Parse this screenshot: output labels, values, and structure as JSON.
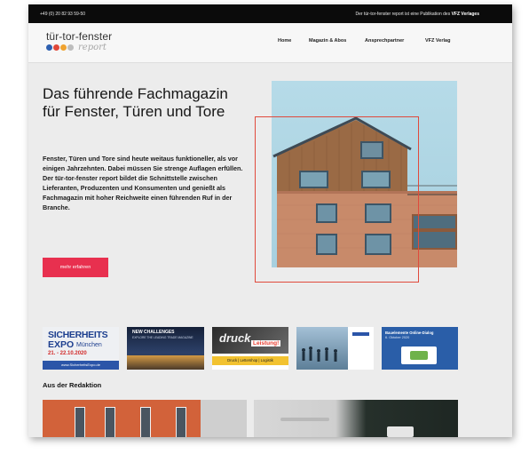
{
  "topbar": {
    "phone": "+49 (0) 20 82 93 59-50",
    "publication_text": "Der tür-tor-fenster report ist eine Publikation des",
    "publisher": "VFZ Verlages"
  },
  "logo": {
    "name": "tür-tor-fenster",
    "sub": "report",
    "dot_colors": [
      "#2d5fb0",
      "#e0483a",
      "#f0a330",
      "#bdbdbd"
    ]
  },
  "nav": {
    "items": [
      {
        "label": "Home"
      },
      {
        "label": "Magazin & Abos"
      },
      {
        "label": "Ansprechpartner"
      },
      {
        "label": "VFZ Verlag"
      }
    ]
  },
  "hero": {
    "title": "Das führende Fachmagazin für Fenster, Türen und Tore",
    "body": "Fenster, Türen und Tore sind heute weitaus funktioneller, als vor einigen Jahrzehnten. Dabei müssen Sie strenge Auflagen erfüllen. Der tür-tor-fenster report bildet die Schnittstelle zwischen Lieferanten, Produzenten und Konsumenten und genießt als Fachmagazin mit hoher Reichweite einen führenden Ruf in der Branche.",
    "cta_label": "mehr erfahren"
  },
  "banners": {
    "sicherheit": {
      "line1": "SICHERHEITS",
      "line2": "EXPO",
      "city": "München",
      "dates": "21. - 22.10.2020",
      "url": "www.SicherheitsExpo.de"
    },
    "challenges": {
      "title": "NEW CHALLENGES",
      "subtitle": "EXPLORE THE LEADING TRADE MAGAZINE"
    },
    "druck": {
      "word": "druck",
      "tag": "Leistung!",
      "footer": "Druck | Lettershop | Logistik"
    },
    "report": {},
    "online": {
      "title": "Bauelemente Online-Dialog",
      "date": "6. Oktober 2020"
    }
  },
  "section": {
    "title": "Aus der Redaktion"
  },
  "colors": {
    "accent": "#e8304f",
    "frame": "#e04a3c",
    "topbar": "#0b0b0b"
  }
}
